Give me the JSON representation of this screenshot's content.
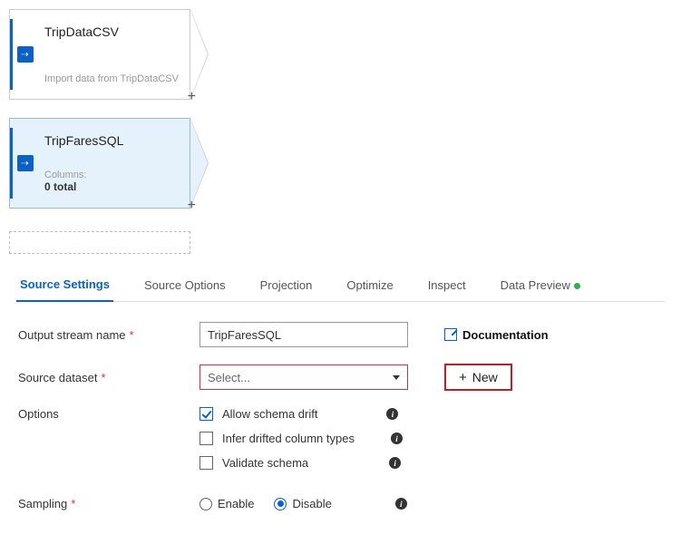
{
  "canvas": {
    "node1": {
      "title": "TripDataCSV",
      "desc": "Import data from TripDataCSV"
    },
    "node2": {
      "title": "TripFaresSQL",
      "columns_label": "Columns:",
      "columns_count": "0 total"
    }
  },
  "tabs": {
    "source_settings": "Source Settings",
    "source_options": "Source Options",
    "projection": "Projection",
    "optimize": "Optimize",
    "inspect": "Inspect",
    "data_preview": "Data Preview"
  },
  "form": {
    "output_stream_label": "Output stream name",
    "output_stream_value": "TripFaresSQL",
    "documentation": "Documentation",
    "source_dataset_label": "Source dataset",
    "select_placeholder": "Select...",
    "new_button": "New",
    "options_label": "Options",
    "allow_schema_drift": "Allow schema drift",
    "infer_drifted": "Infer drifted column types",
    "validate_schema": "Validate schema",
    "sampling_label": "Sampling",
    "enable": "Enable",
    "disable": "Disable"
  }
}
